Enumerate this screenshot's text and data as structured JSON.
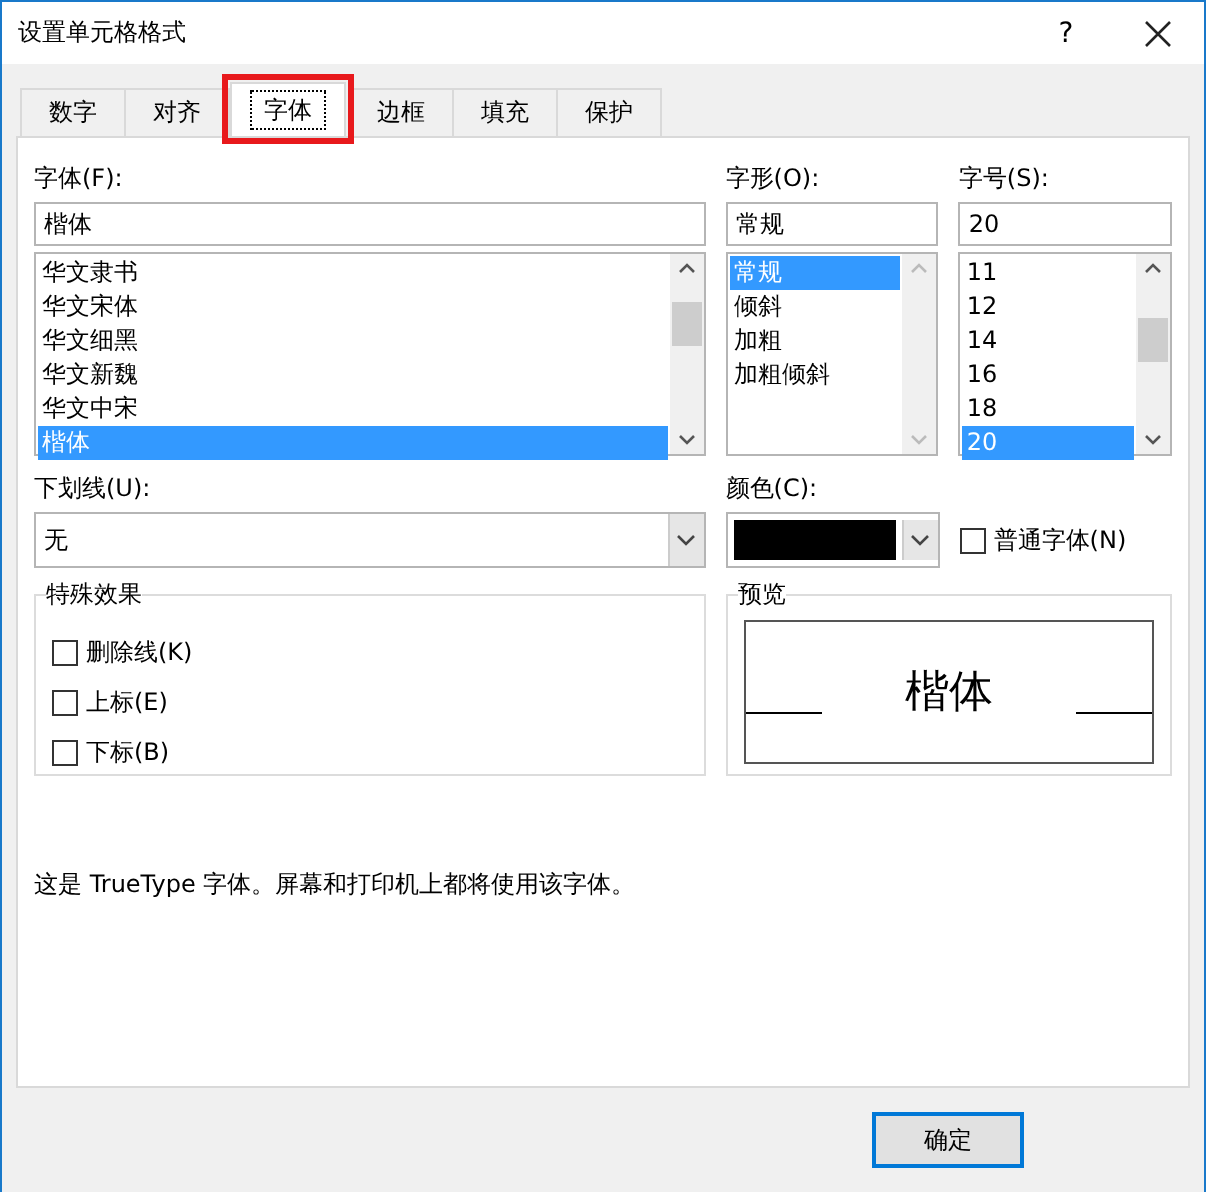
{
  "window": {
    "title": "设置单元格格式",
    "help": "?"
  },
  "tabs": [
    {
      "label": "数字",
      "selected": false,
      "highlighted": false
    },
    {
      "label": "对齐",
      "selected": false,
      "highlighted": false
    },
    {
      "label": "字体",
      "selected": true,
      "highlighted": true
    },
    {
      "label": "边框",
      "selected": false,
      "highlighted": false
    },
    {
      "label": "填充",
      "selected": false,
      "highlighted": false
    },
    {
      "label": "保护",
      "selected": false,
      "highlighted": false
    }
  ],
  "font": {
    "label": "字体(F):",
    "value": "楷体",
    "items": [
      {
        "text": "华文隶书",
        "selected": false
      },
      {
        "text": "华文宋体",
        "selected": false
      },
      {
        "text": "华文细黑",
        "selected": false
      },
      {
        "text": "华文新魏",
        "selected": false
      },
      {
        "text": "华文中宋",
        "selected": false
      },
      {
        "text": "楷体",
        "selected": true
      }
    ]
  },
  "style": {
    "label": "字形(O):",
    "value": "常规",
    "items": [
      {
        "text": "常规",
        "selected": true
      },
      {
        "text": "倾斜",
        "selected": false
      },
      {
        "text": "加粗",
        "selected": false
      },
      {
        "text": "加粗倾斜",
        "selected": false
      }
    ]
  },
  "size": {
    "label": "字号(S):",
    "value": "20",
    "items": [
      {
        "text": "11",
        "selected": false
      },
      {
        "text": "12",
        "selected": false
      },
      {
        "text": "14",
        "selected": false
      },
      {
        "text": "16",
        "selected": false
      },
      {
        "text": "18",
        "selected": false
      },
      {
        "text": "20",
        "selected": true
      }
    ]
  },
  "underline": {
    "label": "下划线(U):",
    "value": "无"
  },
  "color": {
    "label": "颜色(C):",
    "color": "#000000"
  },
  "normal_font": {
    "label": "普通字体(N)",
    "checked": false
  },
  "effects": {
    "title": "特殊效果",
    "items": [
      {
        "label": "删除线(K)",
        "checked": false
      },
      {
        "label": "上标(E)",
        "checked": false
      },
      {
        "label": "下标(B)",
        "checked": false
      }
    ]
  },
  "preview": {
    "title": "预览",
    "sample": "楷体"
  },
  "note": "这是 TrueType 字体。屏幕和打印机上都将使用该字体。",
  "buttons": [
    {
      "label": "确定",
      "default": true
    }
  ]
}
